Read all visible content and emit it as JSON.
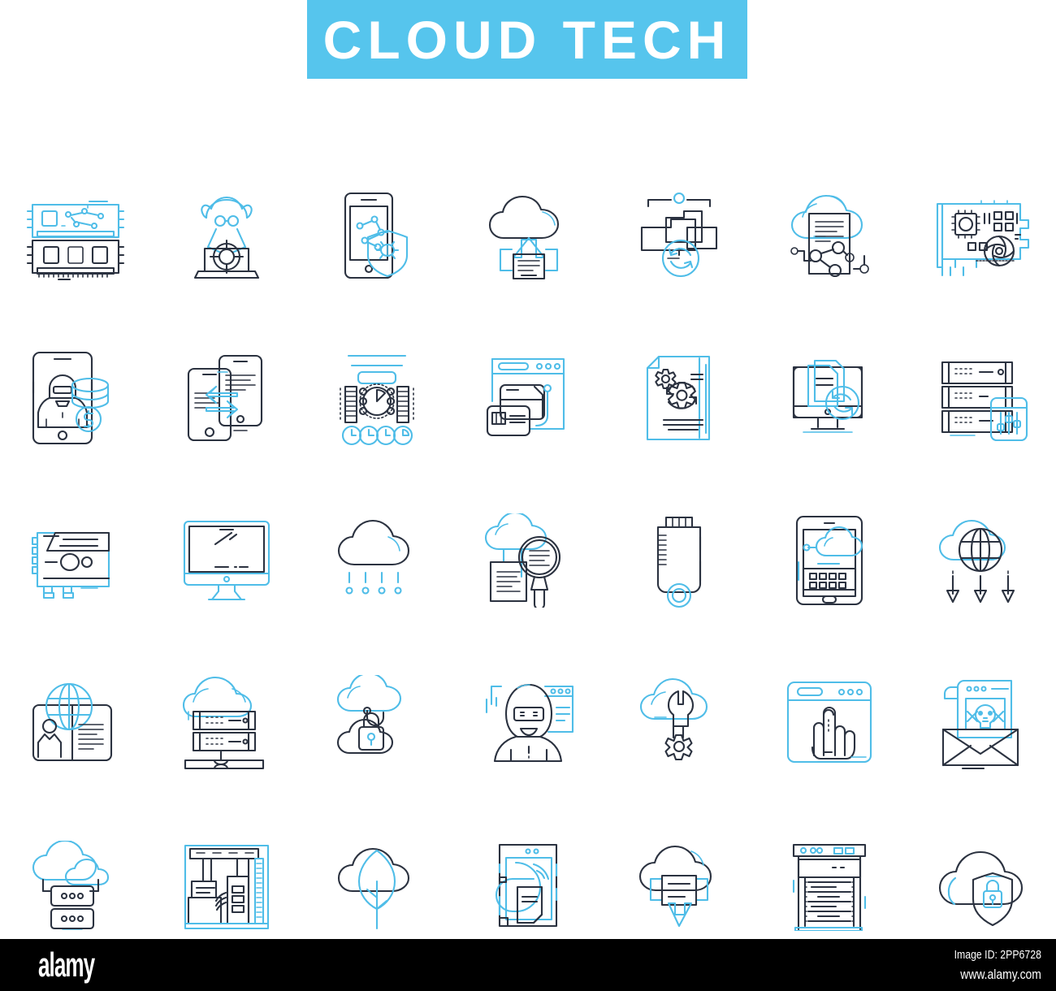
{
  "banner": {
    "title": "CLOUD TECH",
    "background_color": "#56c5ed",
    "text_color": "#ffffff"
  },
  "palette": {
    "dark": "#2b3240",
    "accent": "#4fbde8",
    "background": "#ffffff",
    "footer_background": "#000000"
  },
  "grid": {
    "columns": 7,
    "rows": 5,
    "icons": [
      {
        "name": "ram-memory-module-icon",
        "label": "RAM memory module"
      },
      {
        "name": "hacker-spy-laptop-icon",
        "label": "Hacker spy on laptop"
      },
      {
        "name": "mobile-security-bug-icon",
        "label": "Mobile security bug shield"
      },
      {
        "name": "cloud-upload-document-icon",
        "label": "Cloud upload document"
      },
      {
        "name": "folder-sync-icon",
        "label": "Folder sync"
      },
      {
        "name": "cloud-document-network-icon",
        "label": "Cloud document network"
      },
      {
        "name": "graphics-card-chip-icon",
        "label": "Graphics card chip"
      },
      {
        "name": "mobile-ransomware-icon",
        "label": "Mobile ransomware payment"
      },
      {
        "name": "phone-data-transfer-icon",
        "label": "Phone to phone data transfer"
      },
      {
        "name": "analytics-dashboard-icon",
        "label": "Analytics dashboard"
      },
      {
        "name": "online-card-payment-icon",
        "label": "Online card payment"
      },
      {
        "name": "document-gears-process-icon",
        "label": "Document process gears"
      },
      {
        "name": "desktop-file-sync-icon",
        "label": "Desktop file sync"
      },
      {
        "name": "server-settings-icon",
        "label": "Server rack settings"
      },
      {
        "name": "gpu-video-card-icon",
        "label": "GPU video card"
      },
      {
        "name": "desktop-monitor-icon",
        "label": "Desktop monitor"
      },
      {
        "name": "cloud-rain-data-icon",
        "label": "Cloud raining data"
      },
      {
        "name": "cloud-document-search-icon",
        "label": "Cloud document search"
      },
      {
        "name": "usb-flash-drive-icon",
        "label": "USB flash drive"
      },
      {
        "name": "tablet-cloud-keyboard-icon",
        "label": "Tablet cloud keyboard"
      },
      {
        "name": "global-cloud-download-icon",
        "label": "Global cloud distribution"
      },
      {
        "name": "global-user-profile-icon",
        "label": "Global user profile card"
      },
      {
        "name": "cloud-server-rack-icon",
        "label": "Cloud server rack"
      },
      {
        "name": "cloud-lock-security-icon",
        "label": "Cloud lock security"
      },
      {
        "name": "hacker-browser-icon",
        "label": "Hacker with browser"
      },
      {
        "name": "cloud-maintenance-icon",
        "label": "Cloud maintenance wrench gear"
      },
      {
        "name": "browser-touch-gesture-icon",
        "label": "Browser touch gesture"
      },
      {
        "name": "malware-email-icon",
        "label": "Malware email skull"
      },
      {
        "name": "cloud-storage-stack-icon",
        "label": "Cloud storage stack"
      },
      {
        "name": "data-center-interior-icon",
        "label": "Data center interior"
      },
      {
        "name": "cloud-energy-leaf-icon",
        "label": "Cloud green energy leaf"
      },
      {
        "name": "hard-disk-drive-icon",
        "label": "Hard disk drive file"
      },
      {
        "name": "cloud-download-file-icon",
        "label": "Cloud download file"
      },
      {
        "name": "server-cabinet-icon",
        "label": "Server cabinet"
      },
      {
        "name": "cloud-shield-lock-icon",
        "label": "Cloud shield lock"
      }
    ]
  },
  "footer": {
    "logo": "alamy",
    "image_id": "Image ID: 2PP6728",
    "url": "www.alamy.com"
  }
}
